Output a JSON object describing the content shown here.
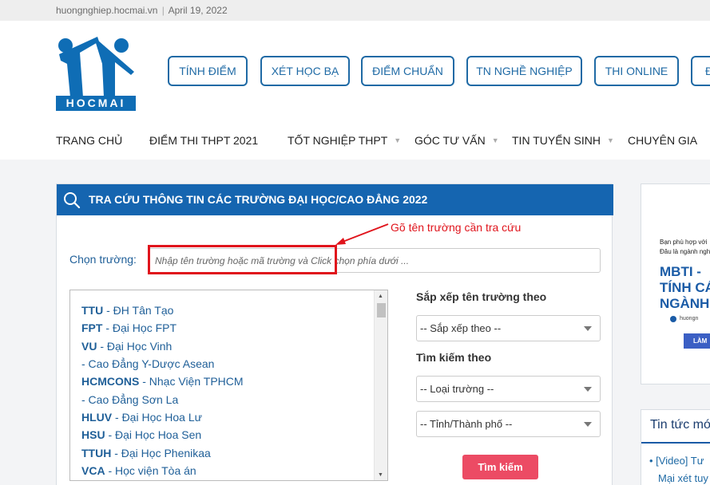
{
  "topbar": {
    "site": "huongnghiep.hocmai.vn",
    "separator": "|",
    "date": "April 19, 2022"
  },
  "logo": {
    "text": "HOCMAI"
  },
  "header_buttons": [
    "TÍNH ĐIỂM",
    "XÉT HỌC BẠ",
    "ĐIỂM CHUẨN",
    "TN NGHỀ NGHIỆP",
    "THI ONLINE",
    "Đ"
  ],
  "nav": [
    "TRANG CHỦ",
    "ĐIỂM THI THPT 2021",
    "TỐT NGHIỆP THPT",
    "GÓC TƯ VẤN",
    "TIN TUYỂN SINH",
    "CHUYÊN GIA"
  ],
  "search_panel": {
    "title": "TRA CỨU THÔNG TIN CÁC TRƯỜNG ĐẠI HỌC/CAO ĐẲNG 2022",
    "annotation": "Gõ tên trường cần tra cứu",
    "school_label": "Chọn trường:",
    "school_placeholder": "Nhập tên trường hoặc mã trường và Click chọn phía dưới ...",
    "schools": [
      {
        "code": "TTU",
        "name": "- ĐH Tân Tạo"
      },
      {
        "code": "FPT",
        "name": "- Đại Học FPT"
      },
      {
        "code": "VU",
        "name": "- Đại Học Vinh"
      },
      {
        "code": "",
        "name": "- Cao Đẳng Y-Dược Asean"
      },
      {
        "code": "HCMCONS",
        "name": "- Nhạc Viện TPHCM"
      },
      {
        "code": "",
        "name": "- Cao Đẳng Sơn La"
      },
      {
        "code": "HLUV",
        "name": "- Đại Học Hoa Lư"
      },
      {
        "code": "HSU",
        "name": "- Đại Học Hoa Sen"
      },
      {
        "code": "TTUH",
        "name": "- Đại Học Phenikaa"
      },
      {
        "code": "VCA",
        "name": "- Học viện Tòa án"
      }
    ],
    "sort_label": "Sắp xếp tên trường theo",
    "sort_value": "-- Sắp xếp theo --",
    "filter_label": "Tìm kiếm theo",
    "type_value": "-- Loại trường --",
    "city_value": "-- Tỉnh/Thành phố --",
    "search_button": "Tìm kiếm"
  },
  "ad": {
    "line1": "Bạn phù hợp với",
    "line2": "Đâu là ngành nghề",
    "big1": "MBTI -",
    "big2": "TÍNH CÁ",
    "big3": "NGÀNH",
    "brand": "huongn",
    "cta": "LÀM"
  },
  "news": {
    "title": "Tin tức mới",
    "item1": "[Video] Tư",
    "item1_cont": "Mại xét tuy"
  },
  "colors": {
    "primary": "#1565b0",
    "button_border": "#1f6aa5",
    "search_button": "#ec4b64",
    "annotation": "#e0141c"
  }
}
